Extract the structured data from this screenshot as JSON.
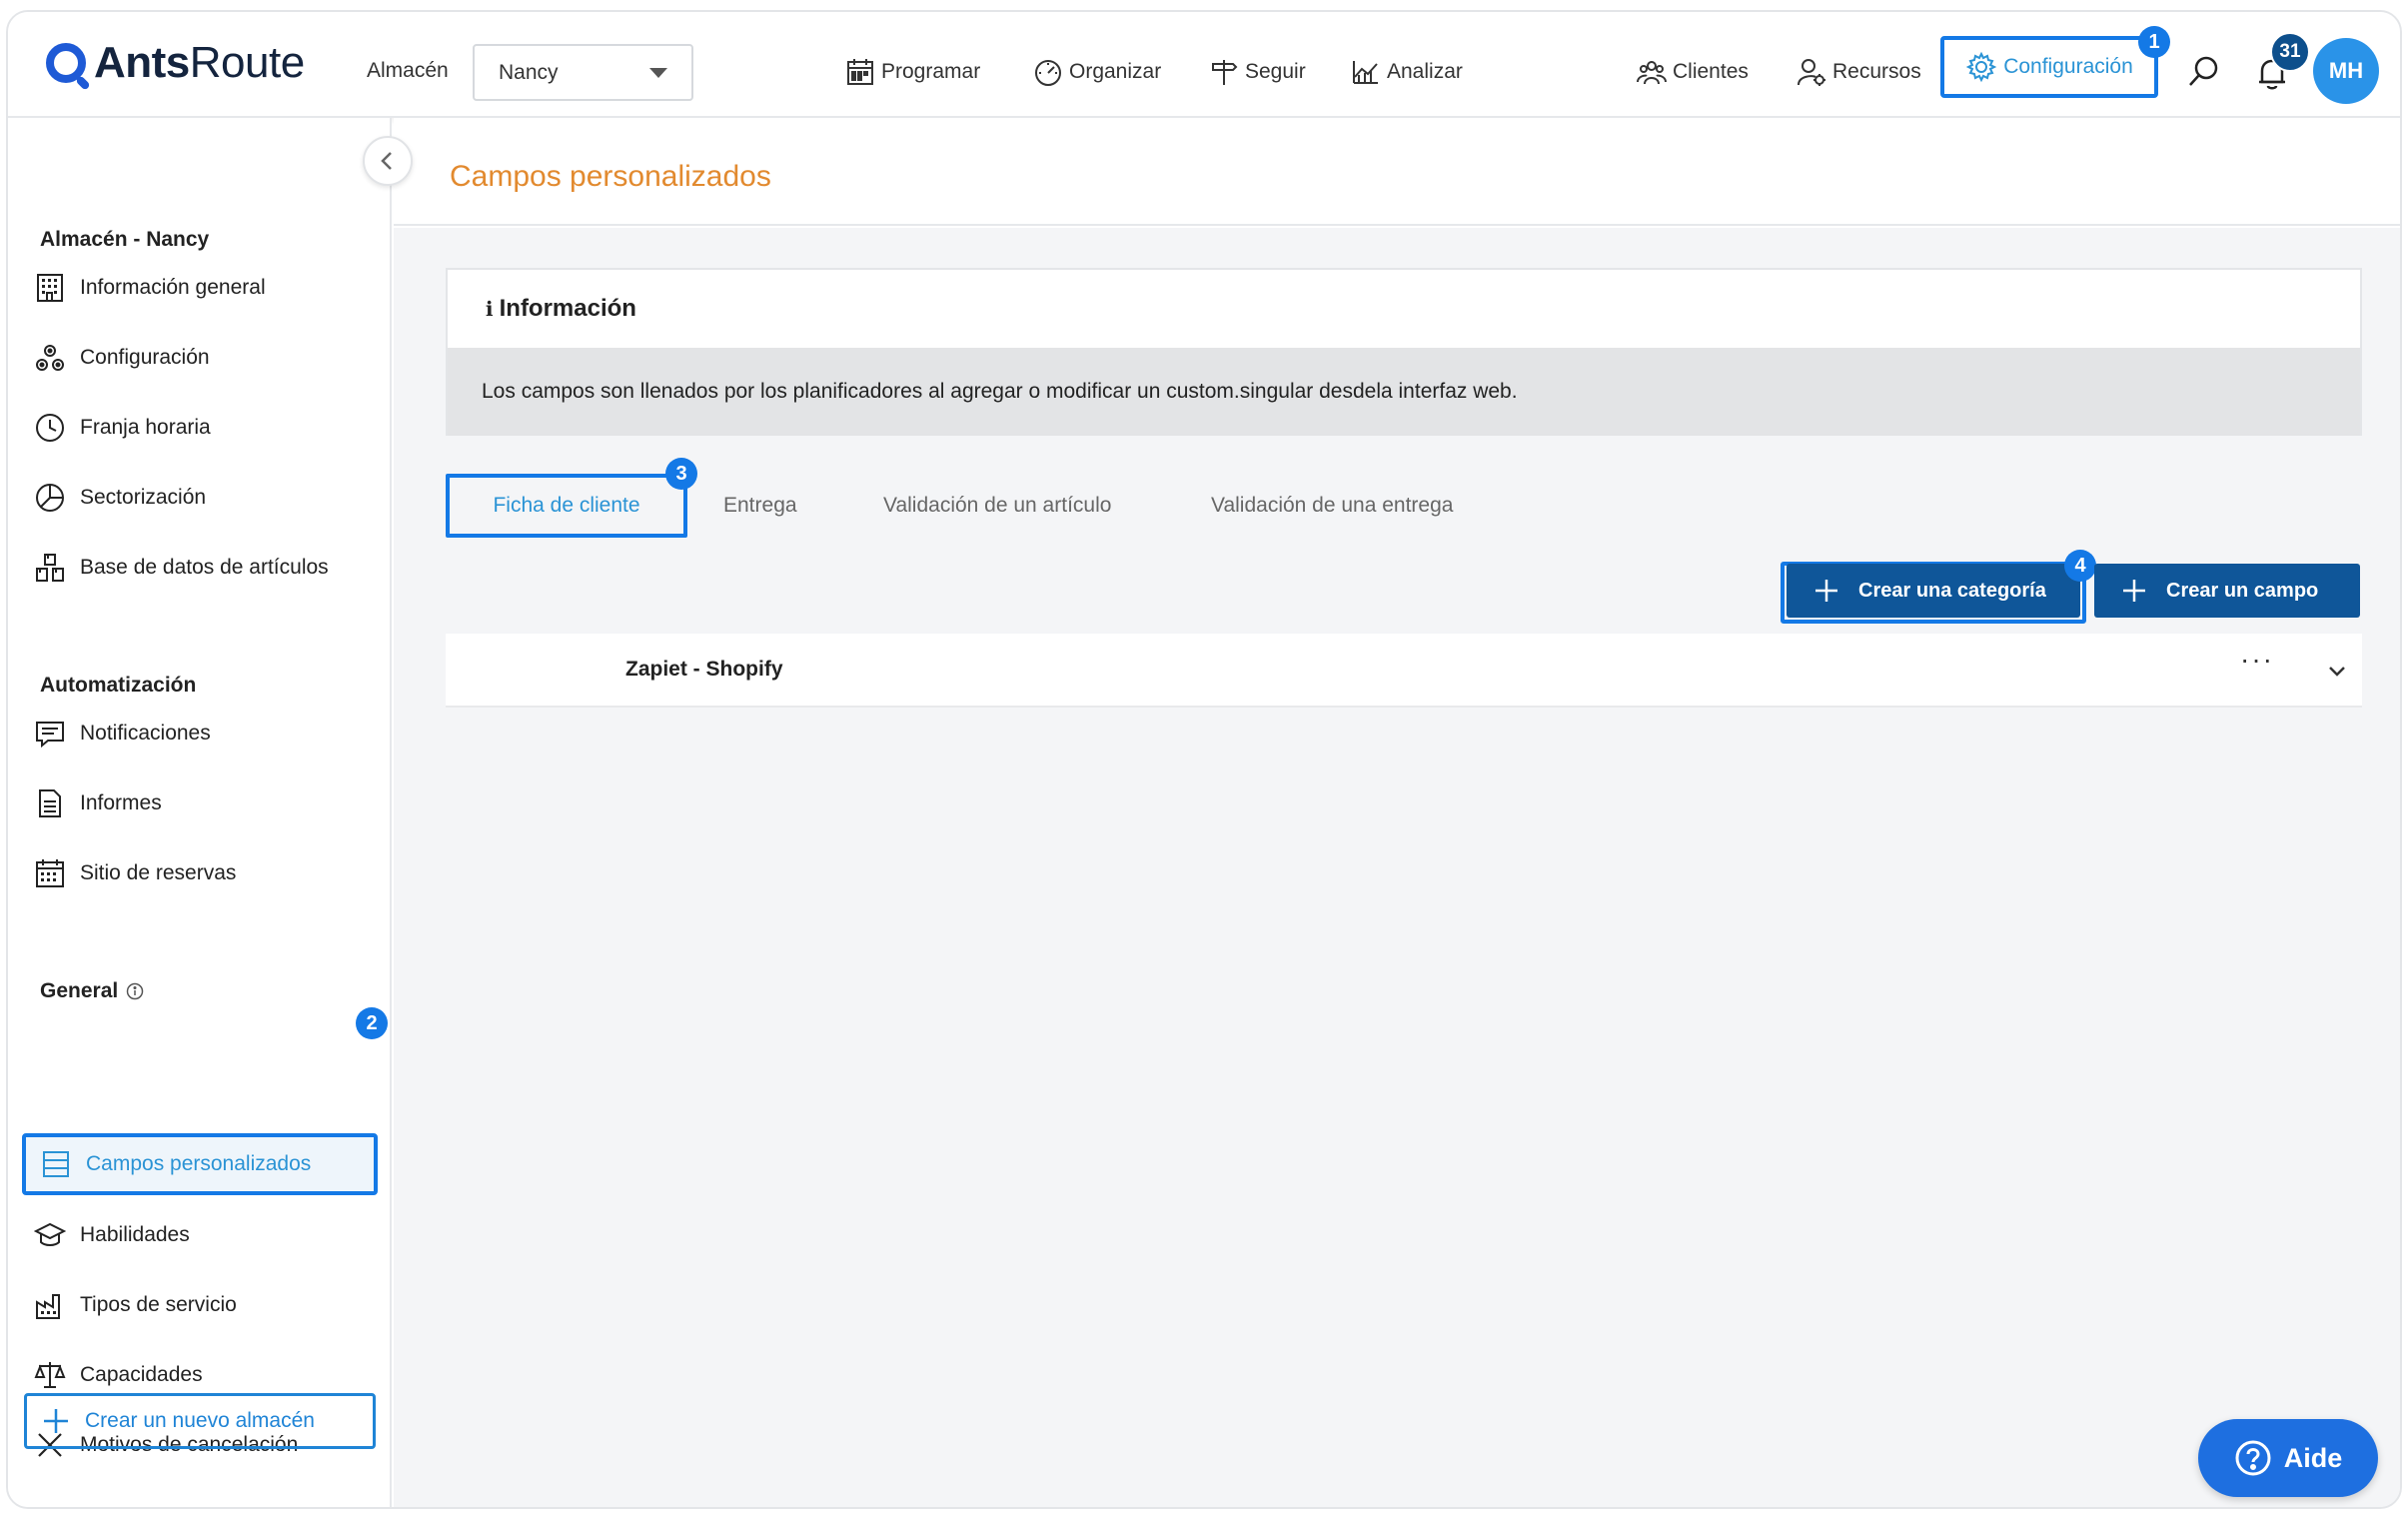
{
  "brand": {
    "name_bold": "Ants",
    "name_regular": "Route"
  },
  "header": {
    "warehouse_label": "Almacén",
    "warehouse_value": "Nancy",
    "nav": [
      "Programar",
      "Organizar",
      "Seguir",
      "Analizar"
    ],
    "right_nav": [
      "Clientes",
      "Recursos",
      "Configuración"
    ],
    "notification_count": "31",
    "avatar_initials": "MH"
  },
  "steps": [
    "1",
    "2",
    "3",
    "4"
  ],
  "sidebar": {
    "section_warehouse": "Almacén - Nancy",
    "warehouse_items": [
      "Información general",
      "Configuración",
      "Franja horaria",
      "Sectorización",
      "Base de datos de artículos"
    ],
    "section_automation": "Automatización",
    "automation_items": [
      "Notificaciones",
      "Informes",
      "Sitio de reservas"
    ],
    "section_general": "General",
    "general_active": "Campos personalizados",
    "general_items": [
      "Habilidades",
      "Tipos de servicio",
      "Capacidades",
      "Motivos de cancelación"
    ],
    "new_warehouse": "Crear un nuevo almacén"
  },
  "main": {
    "page_title": "Campos personalizados",
    "info_icon": "ℹ",
    "info_title": "Información",
    "info_text": "Los campos son llenados por los planificadores al agregar o modificar un custom.singular desdela interfaz web.",
    "tabs": [
      "Ficha de cliente",
      "Entrega",
      "Validación de un artículo",
      "Validación de una entrega"
    ],
    "btn_create_category": "Crear una categoría",
    "btn_create_field": "Crear un campo",
    "category_name": "Zapiet - Shopify",
    "more_glyph": "···"
  },
  "help_button": "Aide",
  "colors": {
    "accent": "#1479e6",
    "dark_button": "#0f5699",
    "title_orange": "#e28a2f",
    "link_blue": "#2a93d5"
  }
}
